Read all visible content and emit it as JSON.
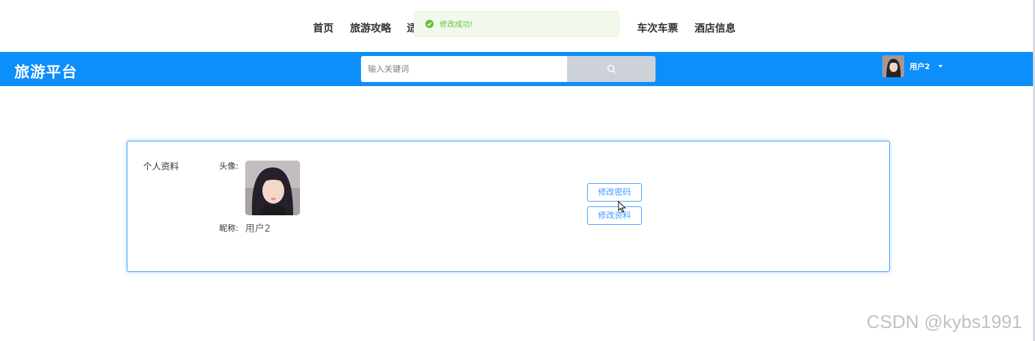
{
  "topnav": {
    "items": [
      {
        "label": "首页"
      },
      {
        "label": "旅游攻略"
      },
      {
        "label": "适"
      },
      {
        "label": "车次车票"
      },
      {
        "label": "酒店信息"
      }
    ]
  },
  "toast": {
    "message": "修改成功!",
    "icon": "check-circle-icon",
    "color": "#67c23a"
  },
  "header": {
    "logo": "旅游平台",
    "search": {
      "placeholder": "输入关键词",
      "value": ""
    },
    "search_icon": "search-icon",
    "user": {
      "name": "用户2",
      "avatar": "avatar-icon",
      "dropdown_icon": "caret-down-icon"
    },
    "accent_color": "#0d8ffb"
  },
  "profile": {
    "section_title": "个人资料",
    "avatar_label": "头像:",
    "nickname_label": "昵称:",
    "nickname_value": "用户2",
    "buttons": {
      "change_password": "修改密码",
      "edit_profile": "修改资料"
    }
  },
  "watermark": "CSDN @kybs1991"
}
